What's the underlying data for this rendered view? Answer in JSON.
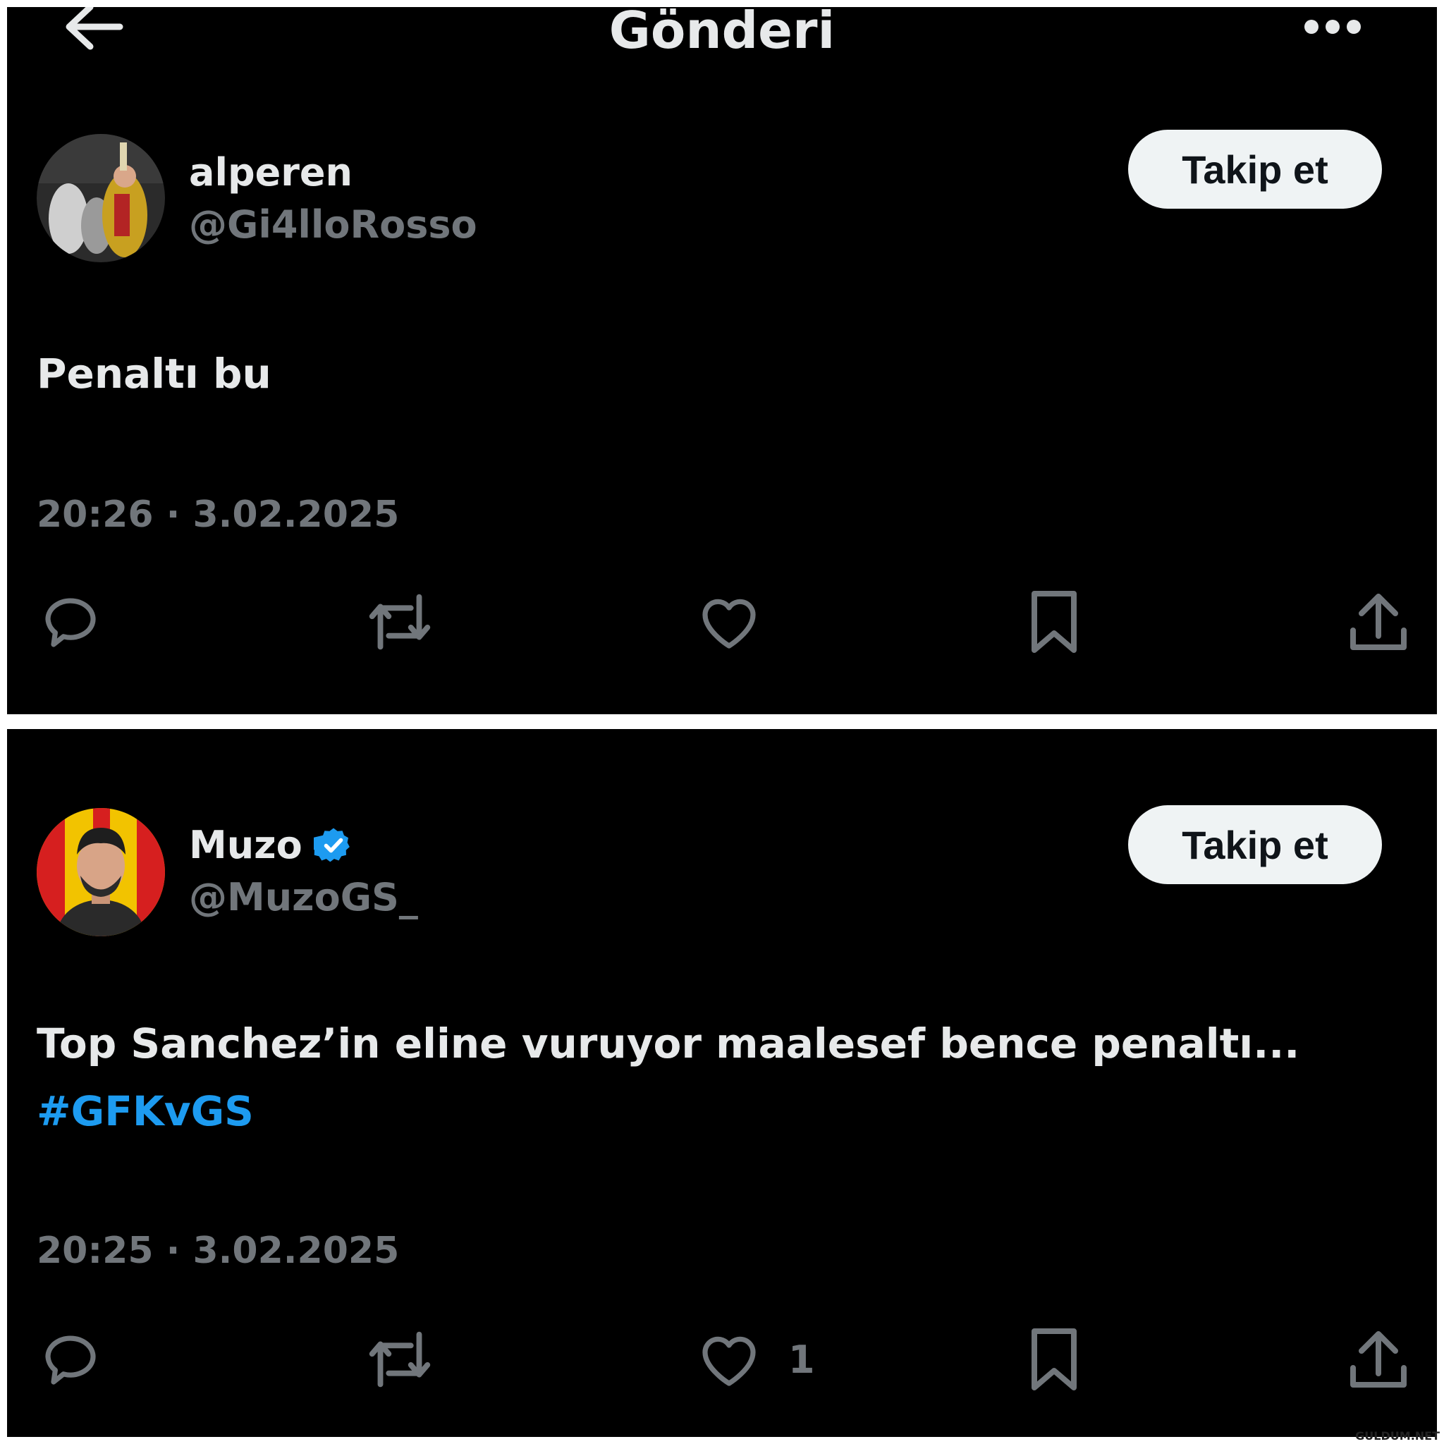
{
  "header": {
    "title": "Gönderi",
    "back_icon": "arrow-left-icon",
    "more_icon": "more-horizontal-icon"
  },
  "posts": [
    {
      "display_name": "alperen",
      "handle": "@Gi4lloRosso",
      "verified": false,
      "follow_label": "Takip et",
      "text_lines": [
        "Penaltı bu"
      ],
      "hashtag": "",
      "timestamp": "20:26 · 3.02.2025",
      "like_count": ""
    },
    {
      "display_name": "Muzo",
      "handle": "@MuzoGS_",
      "verified": true,
      "follow_label": "Takip et",
      "text_lines": [
        "Top Sanchez’in eline vuruyor maalesef bence penaltı..."
      ],
      "hashtag": "#GFKvGS",
      "timestamp": "20:25 · 3.02.2025",
      "like_count": "1"
    }
  ],
  "actions": [
    "reply-icon",
    "repost-icon",
    "like-icon",
    "bookmark-icon",
    "share-icon"
  ],
  "colors": {
    "background": "#000000",
    "primary_text": "#e7e9ea",
    "secondary_text": "#71767b",
    "accent": "#1d9bf0",
    "button_bg": "#eff3f4"
  },
  "watermark": "GULDUM.NET"
}
